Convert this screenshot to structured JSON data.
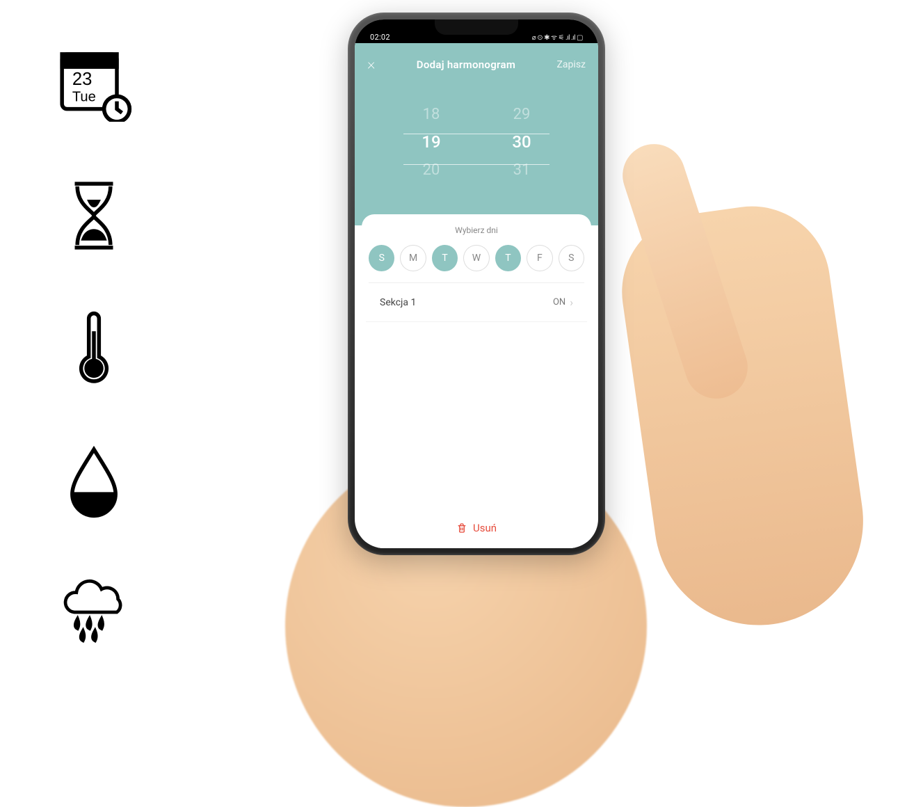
{
  "feature_icons": {
    "calendar": {
      "day": "23",
      "wd": "Tue"
    }
  },
  "status": {
    "time": "02:02",
    "indicators": "⌀ ⊙ ✱ ᯤ ⚟ .ıl .ıl ▢"
  },
  "header": {
    "close": "×",
    "title": "Dodaj harmonogram",
    "save": "Zapisz"
  },
  "picker": {
    "hours": {
      "prevfaint": "",
      "prev": "18",
      "sel": "19",
      "next": "20",
      "nextfaint": ""
    },
    "minutes": {
      "prevfaint": "",
      "prev": "29",
      "sel": "30",
      "next": "31",
      "nextfaint": ""
    }
  },
  "days_panel": {
    "title": "Wybierz dni",
    "days": [
      {
        "label": "S",
        "on": true
      },
      {
        "label": "M",
        "on": false
      },
      {
        "label": "T",
        "on": true
      },
      {
        "label": "W",
        "on": false
      },
      {
        "label": "T",
        "on": true
      },
      {
        "label": "F",
        "on": false
      },
      {
        "label": "S",
        "on": false
      }
    ]
  },
  "section": {
    "label": "Sekcja 1",
    "value": "ON"
  },
  "delete": {
    "label": "Usuń"
  }
}
